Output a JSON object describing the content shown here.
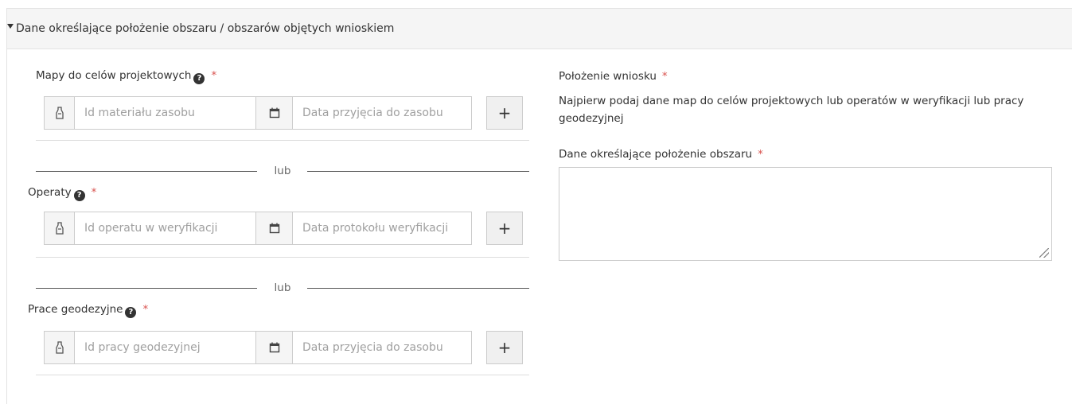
{
  "panel": {
    "title": "Dane określające położenie obszaru / obszarów objętych wnioskiem"
  },
  "left": {
    "divider_label": "lub",
    "groups": [
      {
        "label": "Mapy do celów projektowych",
        "id_placeholder": "Id materiału zasobu",
        "date_placeholder": "Data przyjęcia do zasobu"
      },
      {
        "label": "Operaty",
        "id_placeholder": "Id operatu w weryfikacji",
        "date_placeholder": "Data protokołu weryfikacji"
      },
      {
        "label": "Prace geodezyjne",
        "id_placeholder": "Id pracy geodezyjnej",
        "date_placeholder": "Data przyjęcia do zasobu"
      }
    ]
  },
  "right": {
    "location_label": "Położenie wniosku",
    "location_hint": "Najpierw podaj dane map do celów projektowych lub operatów w weryfikacji lub pracy geodezyjnej",
    "area_label": "Dane określające położenie obszaru",
    "area_value": ""
  },
  "ui": {
    "required_mark": "*",
    "help_glyph": "?",
    "plus_glyph": "+"
  },
  "colors": {
    "required": "#d9534f",
    "header_bg": "#f5f5f5",
    "border": "#cccccc"
  },
  "icons": {
    "id": "id-badge-icon",
    "date": "calendar-icon",
    "help": "question-circle-icon",
    "add": "plus-icon",
    "toggle": "caret-down-icon"
  }
}
